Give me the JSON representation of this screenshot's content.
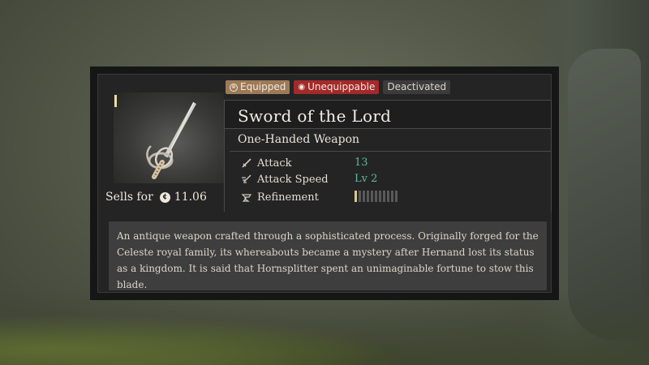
{
  "badges": {
    "equipped": "Equipped",
    "unequippable": "Unequippable",
    "deactivated": "Deactivated"
  },
  "item": {
    "name": "Sword of the Lord",
    "type": "One-Handed Weapon",
    "sells_label": "Sells for",
    "sell_price": "11.06",
    "stats": [
      {
        "label": "Attack",
        "value": "13",
        "icon": "sword-icon"
      },
      {
        "label": "Attack Speed",
        "value": "Lv 2",
        "icon": "speed-icon"
      },
      {
        "label": "Refinement",
        "value": "",
        "icon": "anvil-icon"
      }
    ],
    "refinement_level": 0,
    "description": "An antique weapon crafted through a sophisticated process. Originally forged for the Celeste royal family, its whereabouts became a mystery after Hernand lost its status as a kingdom. It is said that Hornsplitter spent an unimaginable fortune to stow this blade."
  },
  "colors": {
    "equipped": "#9c7a57",
    "unequippable": "#a32a2a",
    "deactivated": "#3b3b3b",
    "stat_value": "#5fb79d"
  }
}
